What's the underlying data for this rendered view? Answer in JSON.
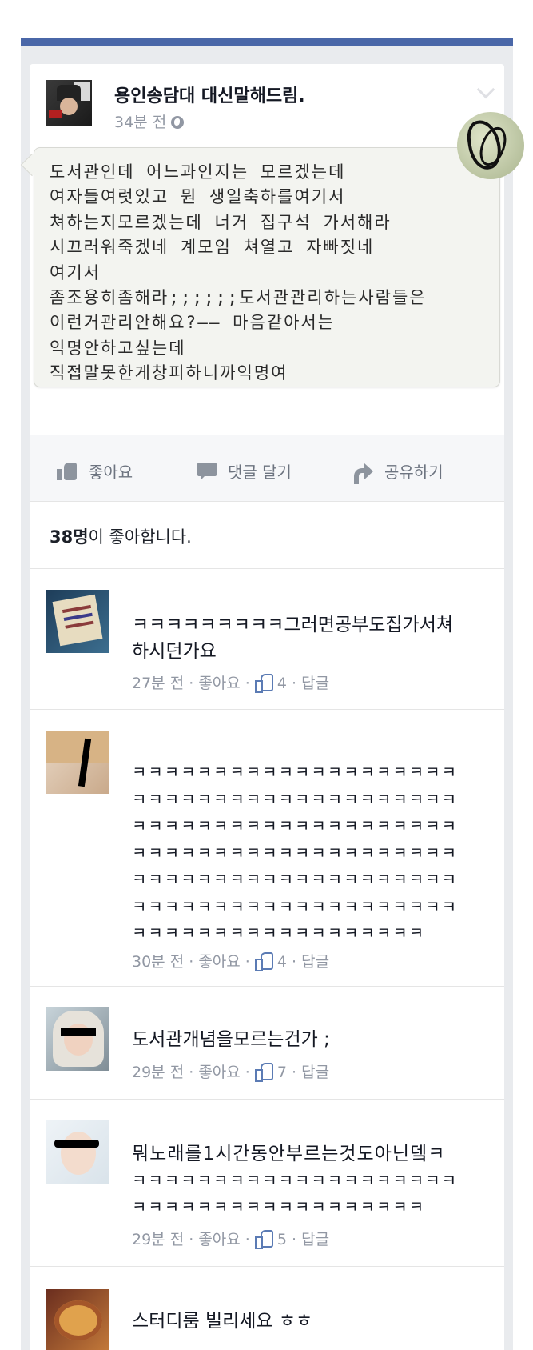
{
  "post": {
    "page_name": "용인송담대 대신말해드림.",
    "time": "34분 전",
    "handwriting_lines": [
      "도서관인데 어느과인지는 모르겠는데",
      "여자들여럿있고 뭔 생일축하를여기서",
      "쳐하는지모르겠는데 너거 집구석 가서해라",
      "시끄러워죽겠네 계모임 쳐열고 자빠짓네",
      "여기서",
      "좀조용히좀해라;;;;;;도서관관리하는사람들은",
      "이런거관리안해요?—— 마음같아서는",
      "익명안하고싶는데",
      "직접말못한게창피하니까익명여"
    ]
  },
  "actions": {
    "like": "좋아요",
    "comment": "댓글 달기",
    "share": "공유하기"
  },
  "likes_summary": {
    "count": "38명",
    "text": "이 좋아합니다."
  },
  "comments": [
    {
      "lines": [
        "ㅋㅋㅋㅋㅋㅋㅋㅋㅋ그러면공부도집가서쳐",
        "하시던가요"
      ],
      "time": "27분 전",
      "like_label": "좋아요",
      "likes": "4",
      "reply_label": "답글"
    },
    {
      "lines": [
        "ㅋㅋㅋㅋㅋㅋㅋㅋㅋㅋㅋㅋㅋㅋㅋㅋㅋㅋㅋㅋ",
        "ㅋㅋㅋㅋㅋㅋㅋㅋㅋㅋㅋㅋㅋㅋㅋㅋㅋㅋㅋㅋ",
        "ㅋㅋㅋㅋㅋㅋㅋㅋㅋㅋㅋㅋㅋㅋㅋㅋㅋㅋㅋㅋ",
        "ㅋㅋㅋㅋㅋㅋㅋㅋㅋㅋㅋㅋㅋㅋㅋㅋㅋㅋㅋㅋ",
        "ㅋㅋㅋㅋㅋㅋㅋㅋㅋㅋㅋㅋㅋㅋㅋㅋㅋㅋㅋㅋ",
        "ㅋㅋㅋㅋㅋㅋㅋㅋㅋㅋㅋㅋㅋㅋㅋㅋㅋㅋㅋㅋ",
        "ㅋㅋㅋㅋㅋㅋㅋㅋㅋㅋㅋㅋㅋㅋㅋㅋㅋㅋ"
      ],
      "time": "30분 전",
      "like_label": "좋아요",
      "likes": "4",
      "reply_label": "답글"
    },
    {
      "lines": [
        "도서관개념을모르는건가 ;"
      ],
      "time": "29분 전",
      "like_label": "좋아요",
      "likes": "7",
      "reply_label": "답글"
    },
    {
      "lines": [
        "뭐노래를1시간동안부르는것도아닌뎈ㅋ",
        "ㅋㅋㅋㅋㅋㅋㅋㅋㅋㅋㅋㅋㅋㅋㅋㅋㅋㅋㅋㅋ",
        "ㅋㅋㅋㅋㅋㅋㅋㅋㅋㅋㅋㅋㅋㅋㅋㅋㅋㅋ"
      ],
      "time": "29분 전",
      "like_label": "좋아요",
      "likes": "5",
      "reply_label": "답글"
    },
    {
      "lines": [
        "스터디룸 빌리세요 ㅎㅎ"
      ]
    }
  ],
  "icons": {
    "privacy": "globe-icon",
    "menu": "chevron-down-icon",
    "like": "thumbs-up-icon",
    "comment": "comment-icon",
    "share": "share-arrow-icon"
  },
  "colors": {
    "header_bar": "#4a67a8",
    "meta_text": "#9197a3",
    "link_blue": "#5b7bb4"
  }
}
